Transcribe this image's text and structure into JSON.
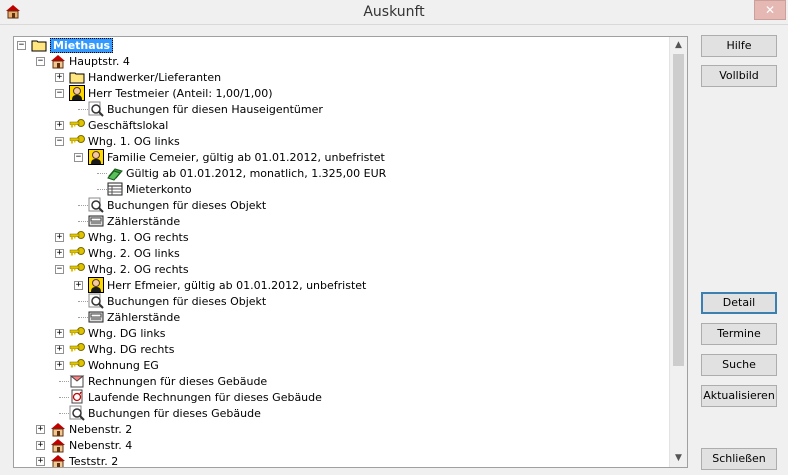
{
  "window": {
    "title": "Auskunft",
    "close_glyph": "✕"
  },
  "tree": [
    {
      "label": "Miethaus",
      "level": 0,
      "icon": "folder-icon",
      "expander": "−",
      "selected": true
    },
    {
      "label": "Hauptstr. 4",
      "level": 1,
      "icon": "house-icon",
      "expander": "−"
    },
    {
      "label": "Handwerker/Lieferanten",
      "level": 2,
      "icon": "folder-icon",
      "expander": "+"
    },
    {
      "label": "Herr Testmeier (Anteil: 1,00/1,00)",
      "level": 2,
      "icon": "person-icon",
      "expander": "−"
    },
    {
      "label": "Buchungen für diesen Hauseigentümer",
      "level": 3,
      "icon": "magnifier-icon",
      "expander": ""
    },
    {
      "label": "Geschäftslokal",
      "level": 2,
      "icon": "key-icon",
      "expander": "+"
    },
    {
      "label": "Whg. 1. OG links",
      "level": 2,
      "icon": "key-icon",
      "expander": "−"
    },
    {
      "label": "Familie Cemeier, gültig ab 01.01.2012, unbefristet",
      "level": 3,
      "icon": "person-icon",
      "expander": "−"
    },
    {
      "label": "Gültig ab 01.01.2012, monatlich, 1.325,00 EUR",
      "level": 4,
      "icon": "money-icon",
      "expander": ""
    },
    {
      "label": "Mieterkonto",
      "level": 4,
      "icon": "account-icon",
      "expander": ""
    },
    {
      "label": "Buchungen für dieses Objekt",
      "level": 3,
      "icon": "magnifier-icon",
      "expander": ""
    },
    {
      "label": "Zählerstände",
      "level": 3,
      "icon": "meter-icon",
      "expander": ""
    },
    {
      "label": "Whg. 1. OG rechts",
      "level": 2,
      "icon": "key-icon",
      "expander": "+"
    },
    {
      "label": "Whg. 2. OG links",
      "level": 2,
      "icon": "key-icon",
      "expander": "+"
    },
    {
      "label": "Whg. 2. OG rechts",
      "level": 2,
      "icon": "key-icon",
      "expander": "−"
    },
    {
      "label": "Herr Efmeier, gültig ab 01.01.2012, unbefristet",
      "level": 3,
      "icon": "person-icon",
      "expander": "+"
    },
    {
      "label": "Buchungen für dieses Objekt",
      "level": 3,
      "icon": "magnifier-icon",
      "expander": ""
    },
    {
      "label": "Zählerstände",
      "level": 3,
      "icon": "meter-icon",
      "expander": ""
    },
    {
      "label": "Whg. DG links",
      "level": 2,
      "icon": "key-icon",
      "expander": "+"
    },
    {
      "label": "Whg. DG rechts",
      "level": 2,
      "icon": "key-icon",
      "expander": "+"
    },
    {
      "label": "Wohnung EG",
      "level": 2,
      "icon": "key-icon",
      "expander": "+"
    },
    {
      "label": "Rechnungen für dieses Gebäude",
      "level": 2,
      "icon": "invoice-icon",
      "expander": ""
    },
    {
      "label": "Laufende Rechnungen für dieses Gebäude",
      "level": 2,
      "icon": "recurring-invoice-icon",
      "expander": ""
    },
    {
      "label": "Buchungen für dieses Gebäude",
      "level": 2,
      "icon": "magnifier-icon",
      "expander": ""
    },
    {
      "label": "Nebenstr. 2",
      "level": 1,
      "icon": "house-icon",
      "expander": "+"
    },
    {
      "label": "Nebenstr. 4",
      "level": 1,
      "icon": "house-icon",
      "expander": "+"
    },
    {
      "label": "Teststr. 2",
      "level": 1,
      "icon": "house-icon",
      "expander": "+"
    }
  ],
  "buttons": {
    "hilfe": "Hilfe",
    "vollbild": "Vollbild",
    "detail": "Detail",
    "termine": "Termine",
    "suche": "Suche",
    "aktualisieren": "Aktualisieren",
    "schliessen": "Schließen"
  },
  "scrollbar": {
    "up_glyph": "▲",
    "down_glyph": "▼"
  },
  "colors": {
    "selection": "#3399ff",
    "house_roof": "#c00000",
    "folder": "#ffe680",
    "key": "#d4b800"
  }
}
